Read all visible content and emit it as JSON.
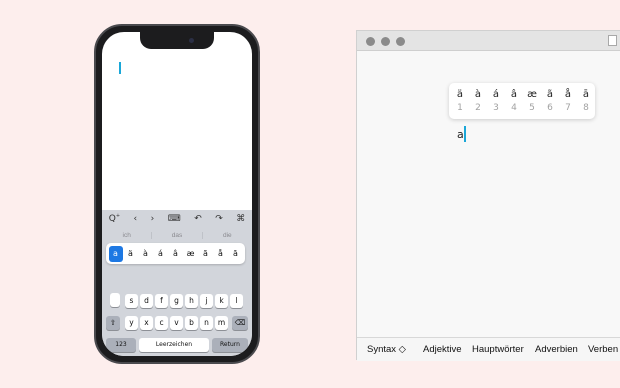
{
  "phone": {
    "suggestions": [
      "ich",
      "das",
      "die"
    ],
    "accent_popup": [
      "a",
      "ä",
      "à",
      "á",
      "â",
      "æ",
      "ã",
      "å",
      "ā"
    ],
    "selected_accent": "a",
    "row2": [
      "s",
      "d",
      "f",
      "g",
      "h",
      "j",
      "k",
      "l"
    ],
    "row3": [
      "y",
      "x",
      "c",
      "v",
      "b",
      "n",
      "m"
    ],
    "numbers_key": "123",
    "space_key": "Leerzeichen",
    "return_key": "Return",
    "toolbar_icons": [
      "search-format-icon",
      "chevron-left-icon",
      "chevron-right-icon",
      "keyboard-icon",
      "undo-icon",
      "redo-icon",
      "command-icon"
    ]
  },
  "mac": {
    "accent_chars": [
      "ä",
      "à",
      "á",
      "â",
      "æ",
      "ã",
      "å",
      "ā"
    ],
    "accent_numbers": [
      "1",
      "2",
      "3",
      "4",
      "5",
      "6",
      "7",
      "8"
    ],
    "typed_text": "a",
    "bottom_bar": {
      "syntax": "Syntax ◇",
      "items": [
        "Adjektive",
        "Hauptwörter",
        "Adverbien",
        "Verben"
      ]
    }
  },
  "colors": {
    "background": "#fdeeed",
    "cursor": "#1aa7d8",
    "selection": "#1d78e3"
  }
}
